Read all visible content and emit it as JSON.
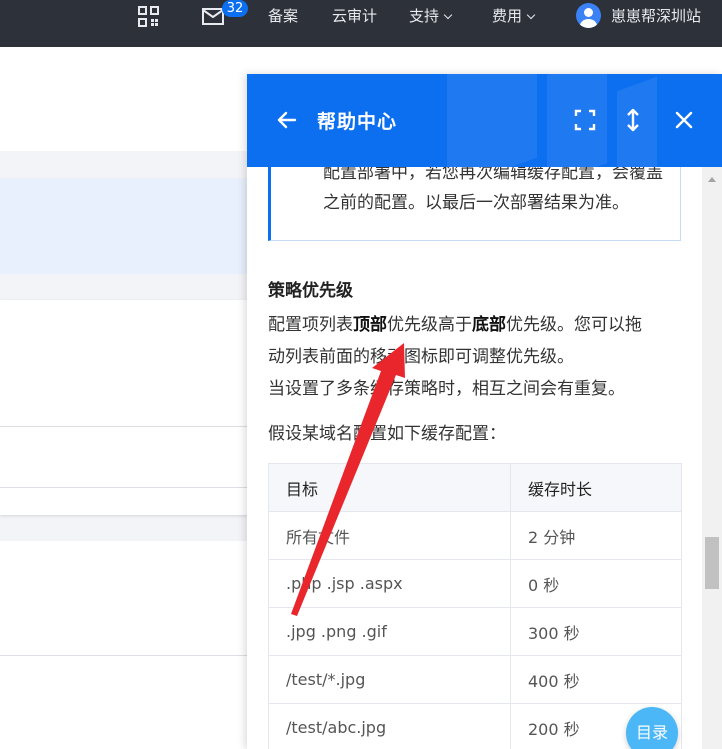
{
  "topbar": {
    "mail_count": "32",
    "items": {
      "filing": "备案",
      "cloud_audit": "云审计",
      "support": "支持",
      "billing": "费用",
      "account": "崽崽帮深圳站"
    }
  },
  "help_panel": {
    "title": "帮助中心",
    "note_text": "配置部署中，若您再次编辑缓存配置，会覆盖之前的配置。以最后一次部署结果为准。",
    "section_title": "策略优先级",
    "priority_pre": "配置项列表",
    "priority_top": "顶部",
    "priority_mid": "优先级高于",
    "priority_bottom": "底部",
    "priority_post": "优先级。您可以拖",
    "priority_line2": "动列表前面的移动图标即可调整优先级。",
    "overlap_text": "当设置了多条缓存策略时，相互之间会有重复。",
    "example_intro": "假设某域名配置如下缓存配置：",
    "table": {
      "headers": [
        "目标",
        "缓存时长"
      ],
      "rows": [
        [
          "所有文件",
          "2 分钟"
        ],
        [
          ".php .jsp .aspx",
          "0 秒"
        ],
        [
          ".jpg .png .gif",
          "300 秒"
        ],
        [
          "/test/*.jpg",
          "400 秒"
        ],
        [
          "/test/abc.jpg",
          "200 秒"
        ]
      ]
    },
    "toc_label": "目录"
  },
  "colors": {
    "topbar_bg": "#2c313a",
    "panel_header_bg": "#0c6ff0",
    "toc_bg": "#4cb7f7",
    "annotation_arrow": "#e8262c"
  }
}
